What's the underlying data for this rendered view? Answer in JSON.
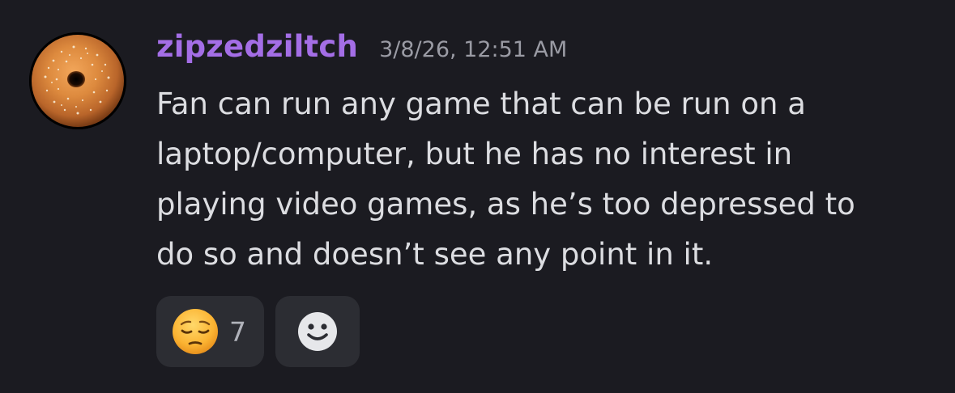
{
  "message": {
    "author": {
      "username": "zipzedziltch",
      "avatar_icon": "bagel-avatar",
      "name_color": "#a46ee6"
    },
    "timestamp": "3/8/26, 12:51 AM",
    "content_lines": [
      "Fan can run any game that can be run on a",
      "laptop/computer, but he has no interest in",
      "playing video games, as he’s too depressed to",
      "do so and doesn’t see any point in it."
    ],
    "reactions": [
      {
        "emoji_icon": "pensive-face-emoji",
        "count": "7"
      }
    ],
    "add_reaction_icon": "smiley-add-reaction-icon"
  },
  "colors": {
    "background": "#1b1b21",
    "reaction_background": "#2c2d33",
    "text": "#dcdde1",
    "muted": "#9a9ba4"
  }
}
